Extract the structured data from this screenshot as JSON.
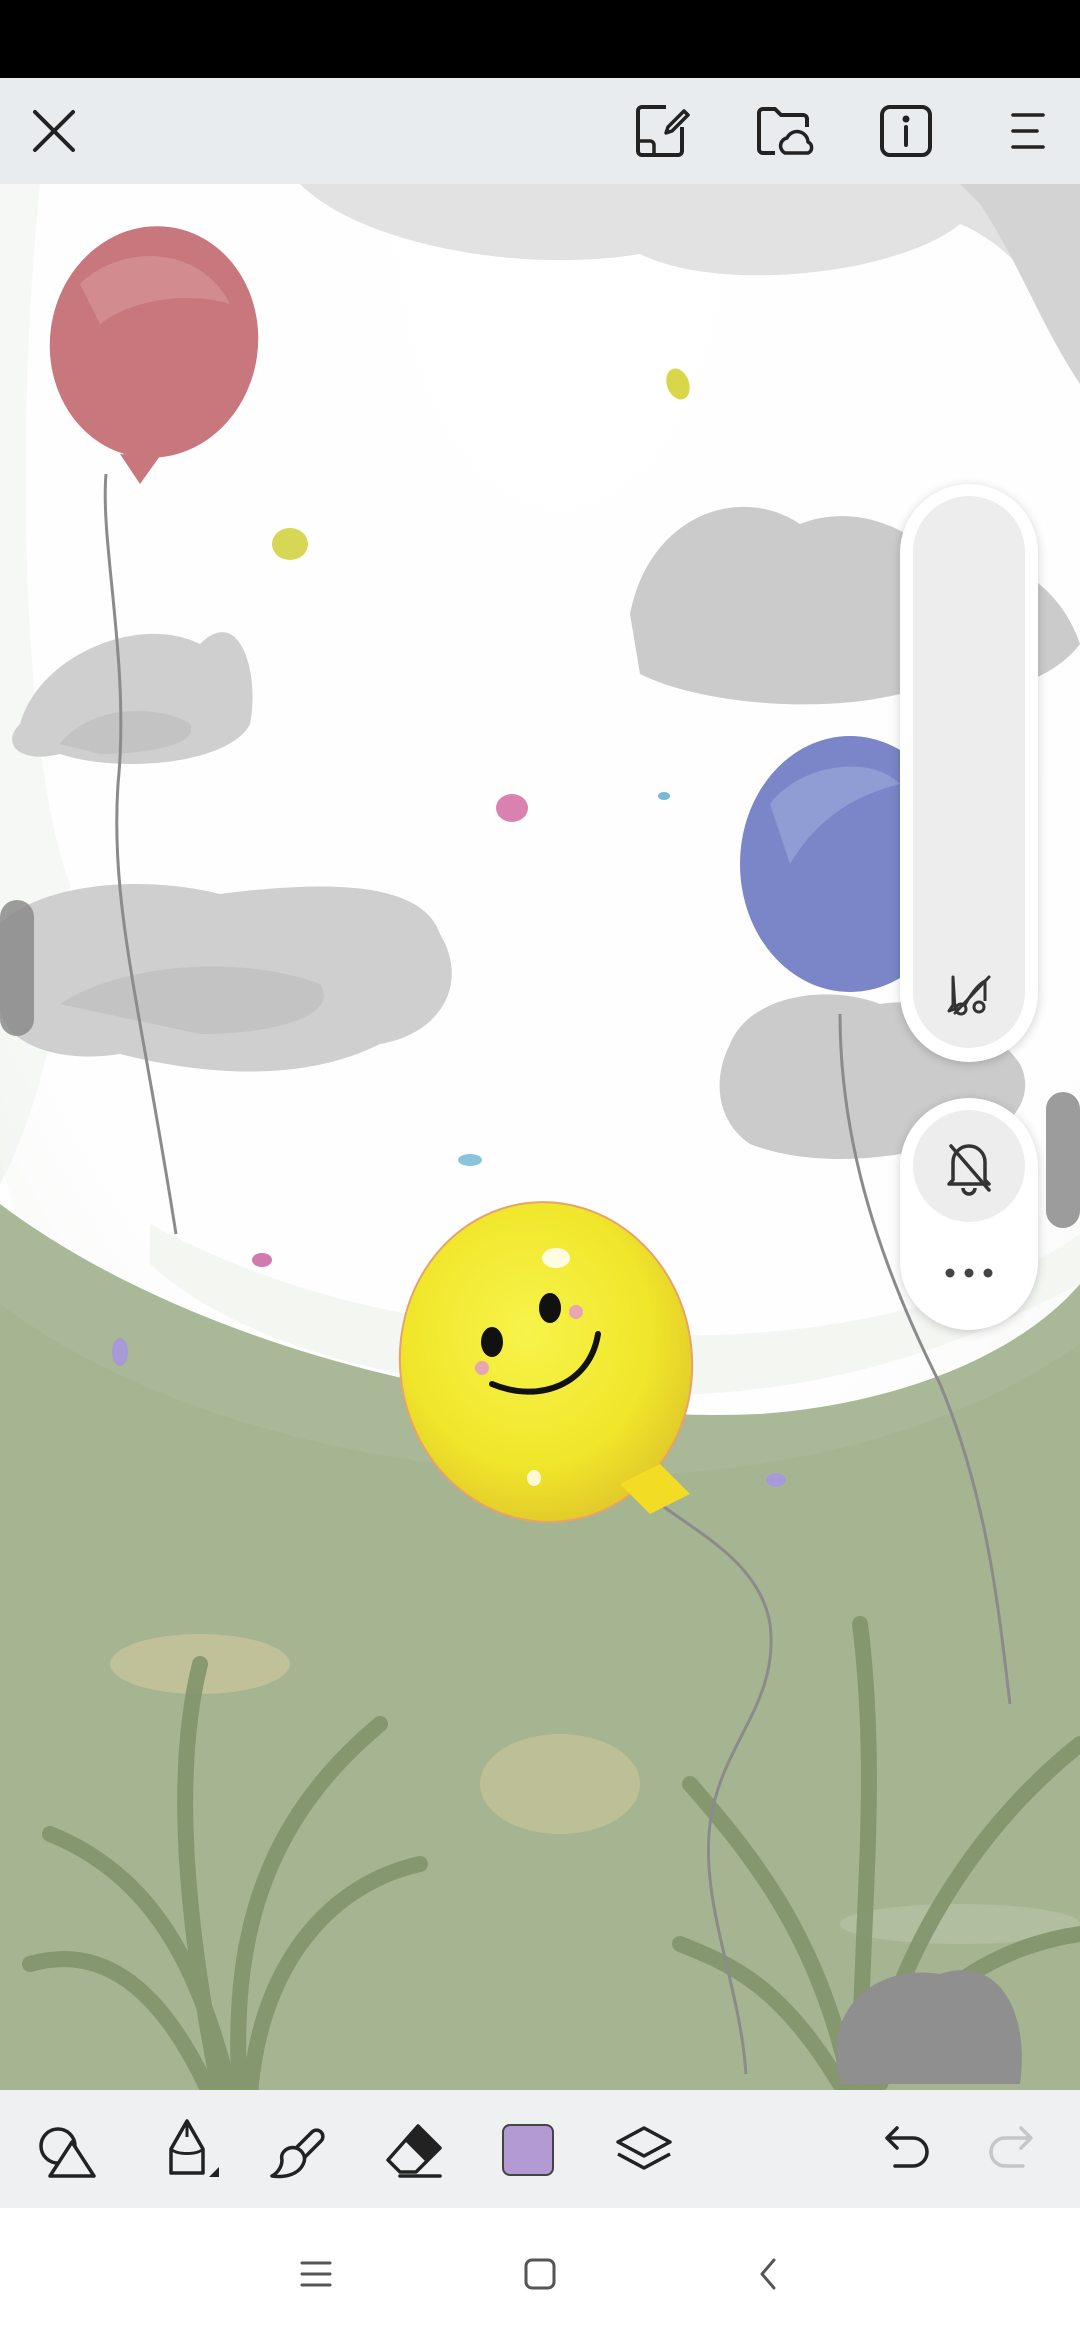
{
  "app": {
    "type": "drawing-canvas"
  },
  "top_bar": {
    "icons": [
      "close-icon",
      "notes-edit-icon",
      "cloud-folder-icon",
      "info-icon",
      "menu-icon"
    ]
  },
  "side_panel": {
    "icons": [
      "pencil-off-icon",
      "bell-off-icon",
      "more-icon"
    ]
  },
  "toolbar": {
    "icons": [
      "shapes-icon",
      "pencil-icon",
      "fill-brush-icon",
      "eraser-icon",
      "color-swatch",
      "layers-icon",
      "undo-icon",
      "redo-icon"
    ],
    "selected_color": "#b49ad2",
    "redo_enabled": false
  },
  "navigation": {
    "icons": [
      "recent-apps-icon",
      "home-icon",
      "back-icon"
    ]
  },
  "colors": {
    "top_bar_bg": "#e9ecee",
    "toolbar_bg": "#eef0f1",
    "sky": "#ffffff",
    "grass": "#a9b896",
    "balloon_red": "#c8777d",
    "balloon_blue": "#7a86c8",
    "balloon_yellow": "#f0ea2a"
  }
}
